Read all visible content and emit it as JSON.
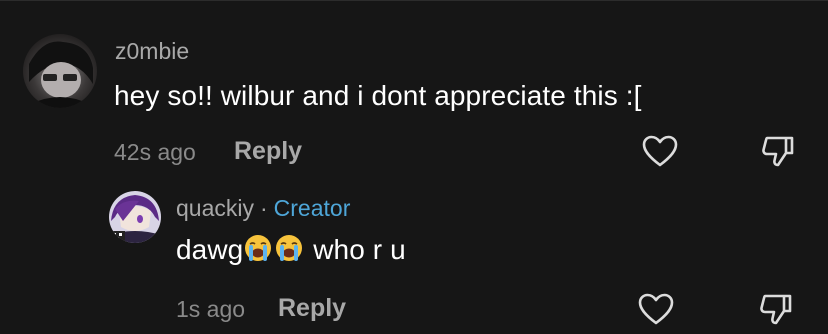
{
  "comments": [
    {
      "username": "z0mbie",
      "text": "hey so!! wilbur and i dont appreciate this :[",
      "time": "42s ago",
      "reply_label": "Reply",
      "avatar_icon": "user-avatar-photo"
    },
    {
      "username": "quackiy",
      "separator": "·",
      "badge": "Creator",
      "text_prefix": "dawg",
      "emojis": [
        "loudly-crying-face",
        "loudly-crying-face"
      ],
      "text_suffix": " who r u",
      "time": "1s ago",
      "reply_label": "Reply",
      "avatar_icon": "anime-avatar"
    }
  ],
  "colors": {
    "background": "#161616",
    "username": "#a8a8a8",
    "creator_badge": "#4ea6d8",
    "text": "#ffffff",
    "meta": "#8a8a8a"
  },
  "icons": [
    "heart-outline-icon",
    "dislike-thumb-icon"
  ]
}
